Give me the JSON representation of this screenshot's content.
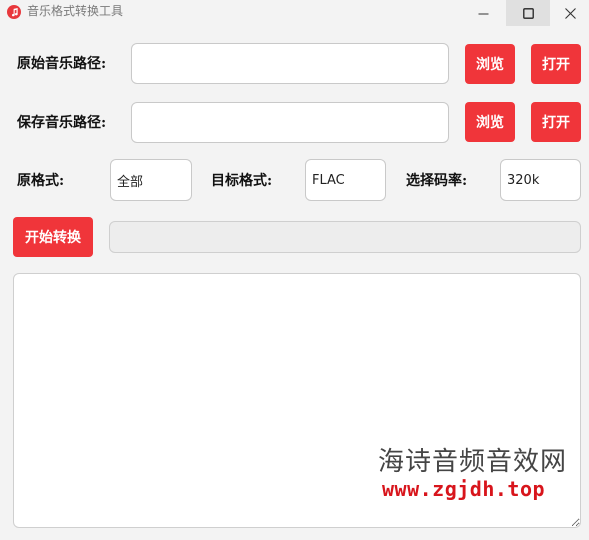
{
  "window": {
    "title": "音乐格式转换工具",
    "accent_color": "#f0353a",
    "icon": "music-note-icon"
  },
  "source": {
    "label": "原始音乐路径:",
    "value": "",
    "browse_label": "浏览",
    "open_label": "打开"
  },
  "save": {
    "label": "保存音乐路径:",
    "value": "",
    "browse_label": "浏览",
    "open_label": "打开"
  },
  "format": {
    "source_label": "原格式:",
    "source_value": "全部",
    "target_label": "目标格式:",
    "target_value": "FLAC",
    "bitrate_label": "选择码率:",
    "bitrate_value": "320k"
  },
  "action": {
    "start_label": "开始转换",
    "progress_percent": 0
  },
  "log": {
    "text": ""
  },
  "watermark": {
    "name": "海诗音频音效网",
    "url": "www.zgjdh.top"
  }
}
